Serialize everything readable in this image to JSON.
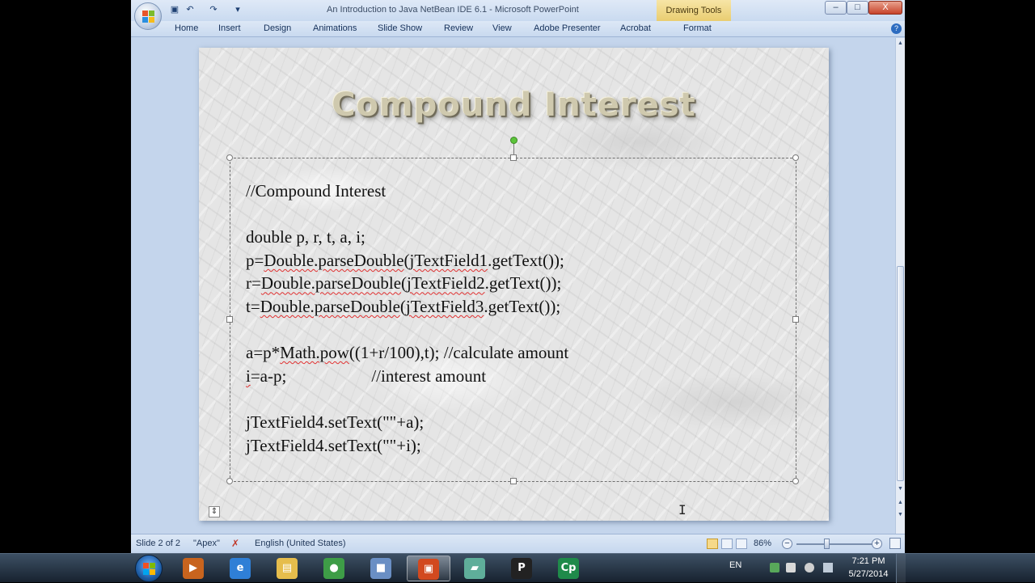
{
  "window": {
    "title": "An Introduction to Java NetBean IDE 6.1 - Microsoft PowerPoint",
    "contextual_tab_group": "Drawing Tools",
    "controls": {
      "minimize": "–",
      "maximize": "□",
      "close": "X"
    }
  },
  "quick_access": [
    "save-icon",
    "undo-icon",
    "redo-icon",
    "customize-icon"
  ],
  "ribbon": {
    "tabs": [
      "Home",
      "Insert",
      "Design",
      "Animations",
      "Slide Show",
      "Review",
      "View",
      "Adobe Presenter",
      "Acrobat",
      "Format"
    ],
    "help": "?"
  },
  "slide": {
    "title": "Compound Interest",
    "code_lines": [
      "//Compound Interest",
      "",
      "double p, r, t, a, i;",
      "p=Double.parseDouble(jTextField1.getText());",
      "r=Double.parseDouble(jTextField2.getText());",
      "t=Double.parseDouble(jTextField3.getText());",
      "",
      "a=p*Math.pow((1+r/100),t); //calculate amount",
      "i=a-p;                    //interest amount",
      "",
      "jTextField4.setText(\"\"+a);",
      "jTextField4.setText(\"\"+i);"
    ],
    "cursor": "I"
  },
  "statusbar": {
    "slide_info": "Slide 2 of 2",
    "theme": "\"Apex\"",
    "language": "English (United States)",
    "zoom": "86%",
    "zoom_minus": "−",
    "zoom_plus": "+"
  },
  "taskbar": {
    "apps": [
      {
        "name": "media-app",
        "color": "#c8641e"
      },
      {
        "name": "internet-explorer",
        "color": "#2f7fd6"
      },
      {
        "name": "file-explorer",
        "color": "#e6bd4c"
      },
      {
        "name": "chrome",
        "color": "#3e9d47"
      },
      {
        "name": "virtualbox",
        "color": "#6a8fc4"
      },
      {
        "name": "powerpoint",
        "color": "#d2491f"
      },
      {
        "name": "notepad-app",
        "color": "#5fae9a"
      },
      {
        "name": "p-app",
        "color": "#222222"
      },
      {
        "name": "captivate",
        "color": "#1f8a4a"
      }
    ],
    "language": "EN",
    "time": "7:21 PM",
    "date": "5/27/2014"
  }
}
